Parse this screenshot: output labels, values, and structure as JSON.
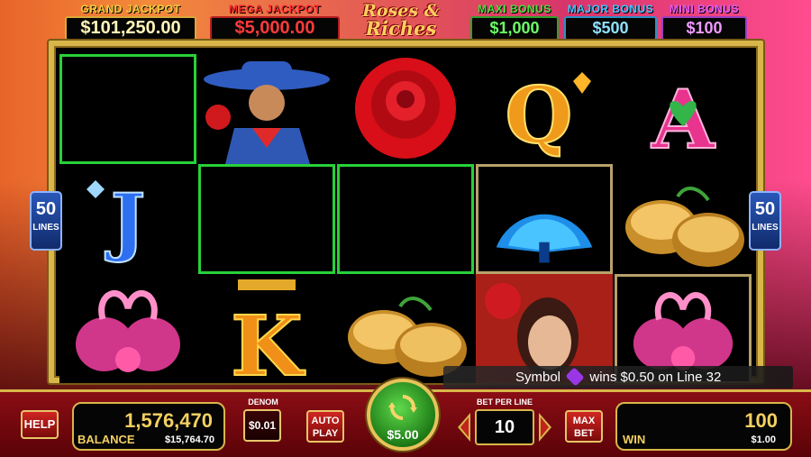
{
  "jackpots": {
    "grand": {
      "label": "GRAND JACKPOT",
      "value": "$101,250.00"
    },
    "mega": {
      "label": "MEGA JACKPOT",
      "value": "$5,000.00"
    },
    "maxi": {
      "label": "MAXI BONUS",
      "value": "$1,000"
    },
    "major": {
      "label": "MAJOR BONUS",
      "value": "$500"
    },
    "mini": {
      "label": "MINI BONUS",
      "value": "$100"
    }
  },
  "logo": {
    "line1": "Roses &",
    "line2": "Riches"
  },
  "lines": {
    "count": "50",
    "label": "LINES"
  },
  "reels": {
    "symbols": [
      [
        "blank",
        "j-blue",
        "swan-glasses"
      ],
      [
        "caballero",
        "blank",
        "k-gold"
      ],
      [
        "rose-wild",
        "blank",
        "castanets"
      ],
      [
        "q-gold",
        "fan",
        "senorita"
      ],
      [
        "a-pink",
        "castanets",
        "swan-glasses"
      ]
    ],
    "highlighted": [
      "0-0",
      "1-1",
      "2-1"
    ],
    "selected": [
      "3-1",
      "4-2"
    ]
  },
  "win_message": {
    "prefix": "Symbol",
    "suffix": "wins $0.50 on Line 32"
  },
  "controls": {
    "help": "HELP",
    "balance": {
      "credits": "1,576,470",
      "label": "BALANCE",
      "cash": "$15,764.70"
    },
    "denom": {
      "label": "DENOM",
      "value": "$0.01"
    },
    "auto_play": {
      "line1": "AUTO",
      "line2": "PLAY"
    },
    "spin": {
      "bet": "$5.00"
    },
    "bet_per_line": {
      "label": "BET PER LINE",
      "value": "10"
    },
    "max_bet": {
      "line1": "MAX",
      "line2": "BET"
    },
    "win": {
      "credits": "100",
      "label": "WIN",
      "cash": "$1.00"
    }
  },
  "colors": {
    "highlight": "#27d13a",
    "gold": "#d8b64a"
  }
}
